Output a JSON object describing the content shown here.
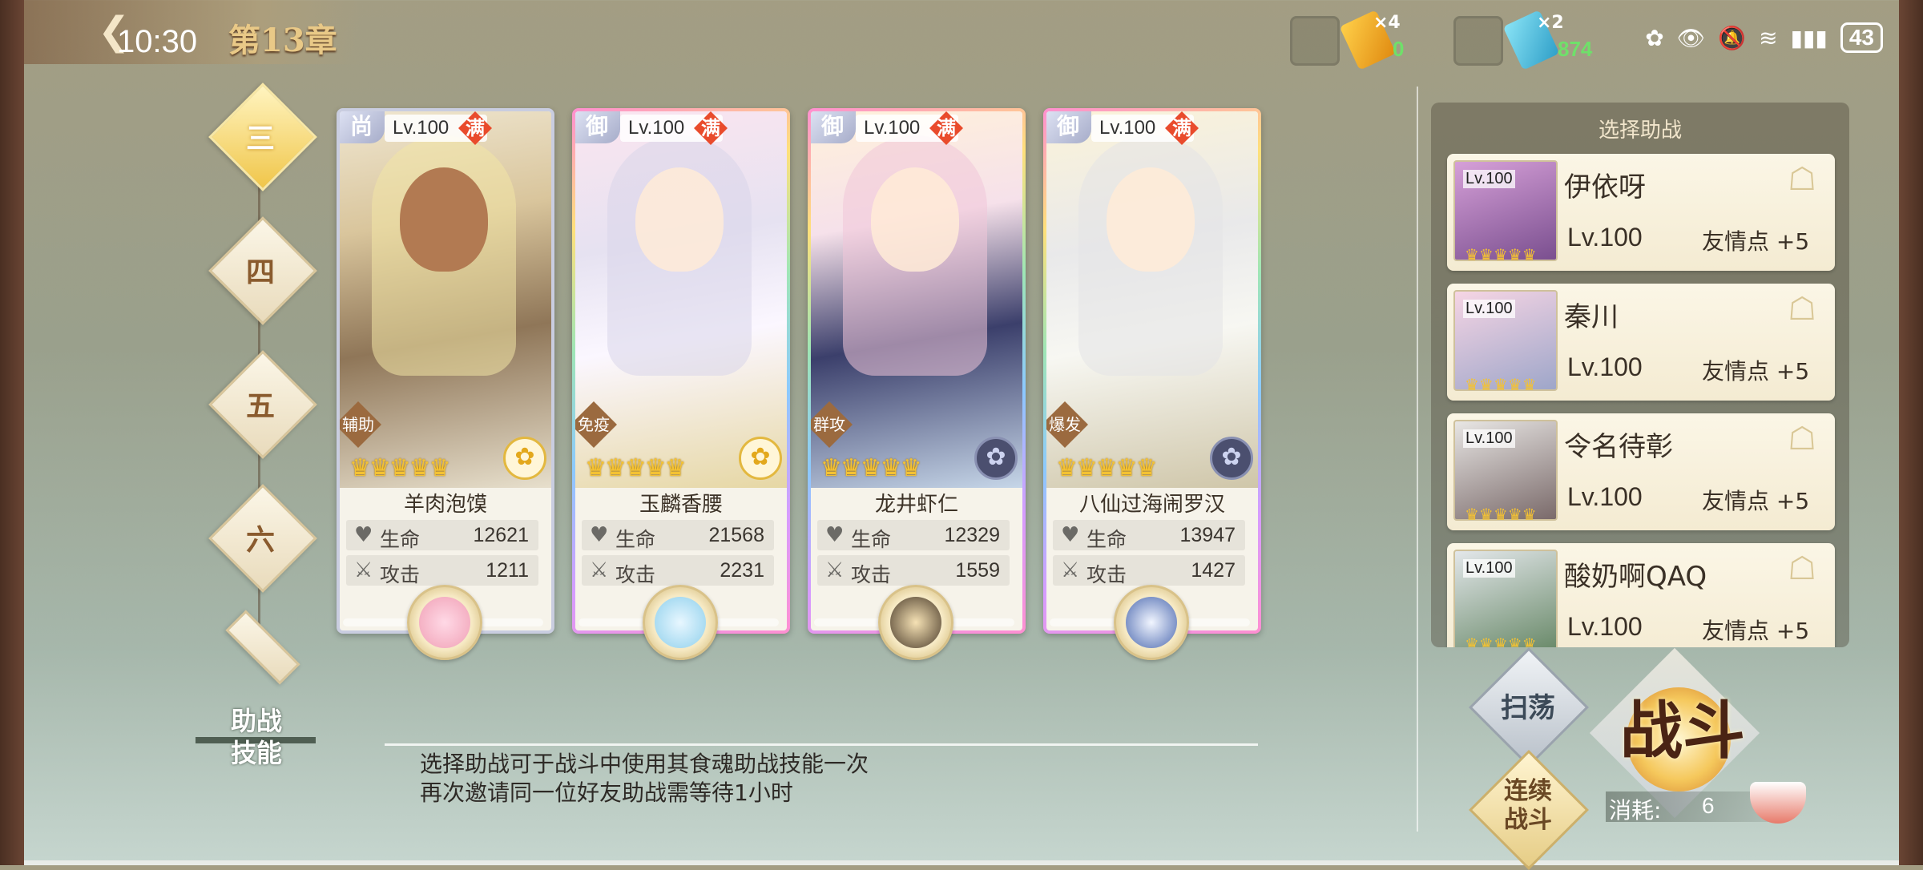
{
  "status_bar": {
    "time": "10:30",
    "battery": "43"
  },
  "header": {
    "chapter": "第13章"
  },
  "resources": [
    {
      "multiplier": "×4",
      "count": "0",
      "color": "#f0b020"
    },
    {
      "multiplier": "×2",
      "count": "874",
      "color": "#3eb6d8"
    }
  ],
  "chapters": [
    "三",
    "四",
    "五",
    "六"
  ],
  "cards": [
    {
      "type": "尚",
      "level": "Lv.100",
      "max": "满",
      "role": "辅助",
      "stars": "♛♛♛♛♛",
      "name": "羊肉泡馍",
      "hp_label": "生命",
      "hp": "12621",
      "atk_label": "攻击",
      "atk": "1211"
    },
    {
      "type": "御",
      "level": "Lv.100",
      "max": "满",
      "role": "免疫",
      "stars": "♛♛♛♛♛",
      "name": "玉麟香腰",
      "hp_label": "生命",
      "hp": "21568",
      "atk_label": "攻击",
      "atk": "2231"
    },
    {
      "type": "御",
      "level": "Lv.100",
      "max": "满",
      "role": "群攻",
      "stars": "♛♛♛♛♛",
      "name": "龙井虾仁",
      "hp_label": "生命",
      "hp": "12329",
      "atk_label": "攻击",
      "atk": "1559"
    },
    {
      "type": "御",
      "level": "Lv.100",
      "max": "满",
      "role": "爆发",
      "stars": "♛♛♛♛♛",
      "name": "八仙过海闹罗汉",
      "hp_label": "生命",
      "hp": "13947",
      "atk_label": "攻击",
      "atk": "1427"
    }
  ],
  "skill": {
    "label_line1": "助战",
    "label_line2": "技能",
    "desc_line1": "选择助战可于战斗中使用其食魂助战技能一次",
    "desc_line2": "再次邀请同一位好友助战需等待1小时"
  },
  "helper_panel": {
    "title": "选择助战",
    "friends": [
      {
        "name": "伊依呀",
        "avatar_level": "Lv.100",
        "level": "Lv.100",
        "points": "友情点 +5",
        "stars": "♛♛♛♛♛"
      },
      {
        "name": "秦川",
        "avatar_level": "Lv.100",
        "level": "Lv.100",
        "points": "友情点 +5",
        "stars": "♛♛♛♛♛"
      },
      {
        "name": "令名待彰",
        "avatar_level": "Lv.100",
        "level": "Lv.100",
        "points": "友情点 +5",
        "stars": "♛♛♛♛♛"
      },
      {
        "name": "酸奶啊QAQ",
        "avatar_level": "Lv.100",
        "level": "Lv.100",
        "points": "友情点 +5",
        "stars": "♛♛♛♛♛"
      }
    ]
  },
  "actions": {
    "sweep": "扫荡",
    "continuous_line1": "连续",
    "continuous_line2": "战斗",
    "fight": "战斗",
    "cost_label": "消耗:",
    "cost_value": "6"
  }
}
